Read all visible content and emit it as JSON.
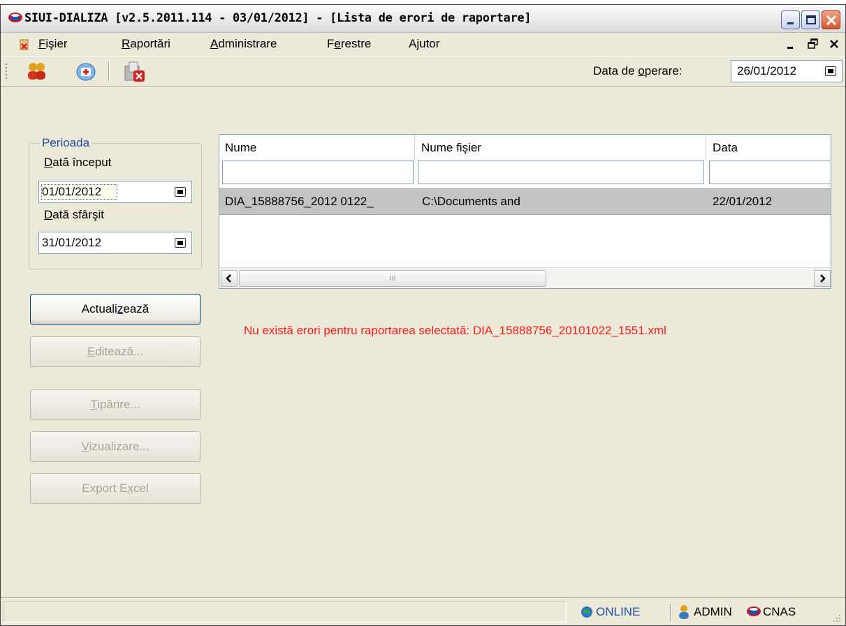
{
  "window": {
    "title": "SIUI-DIALIZA [v2.5.2011.114 - 03/01/2012] - [Lista de erori de raportare]"
  },
  "menu": {
    "items": [
      {
        "first": "F",
        "rest": "işier"
      },
      {
        "first": "R",
        "rest": "aportări"
      },
      {
        "first": "A",
        "rest": "dministrare"
      },
      {
        "pre": "F",
        "first": "e",
        "rest": "restre"
      },
      {
        "pre": "A",
        "first": "j",
        "rest": "utor"
      }
    ]
  },
  "toolbar": {
    "operating_date_label_pre": "Data de ",
    "operating_date_label_u": "o",
    "operating_date_label_post": "perare:",
    "operating_date": "26/01/2012"
  },
  "period": {
    "legend": "Perioada",
    "start_label_u": "D",
    "start_label_rest": "ată început",
    "start_value": "01/01/2012",
    "end_label_u": "D",
    "end_label_rest": "ată sfârşit",
    "end_value": "31/01/2012"
  },
  "buttons": {
    "refresh_pre": "Actuali",
    "refresh_u": "z",
    "refresh_post": "ează",
    "edit_u": "E",
    "edit_rest": "ditează...",
    "print_u": "T",
    "print_rest": "ipărire...",
    "view_u": "V",
    "view_rest": "izualizare...",
    "export_pre": "Export E",
    "export_u": "x",
    "export_post": "cel"
  },
  "grid": {
    "columns": [
      "Nume",
      "Nume fişier",
      "Data"
    ],
    "rows": [
      {
        "nume": "DIA_15888756_2012 0122_",
        "fisier": "C:\\Documents and",
        "data": "22/01/2012"
      }
    ],
    "scroll_grip": "III"
  },
  "message": "Nu există erori pentru raportarea selectată: DIA_15888756_20101022_1551.xml",
  "status": {
    "online": "ONLINE",
    "user": "ADMIN",
    "org": "CNAS"
  },
  "colors": {
    "accent_blue": "#1e50a2",
    "error_red": "#ff1a1a",
    "window_bg": "#ece9d8"
  }
}
